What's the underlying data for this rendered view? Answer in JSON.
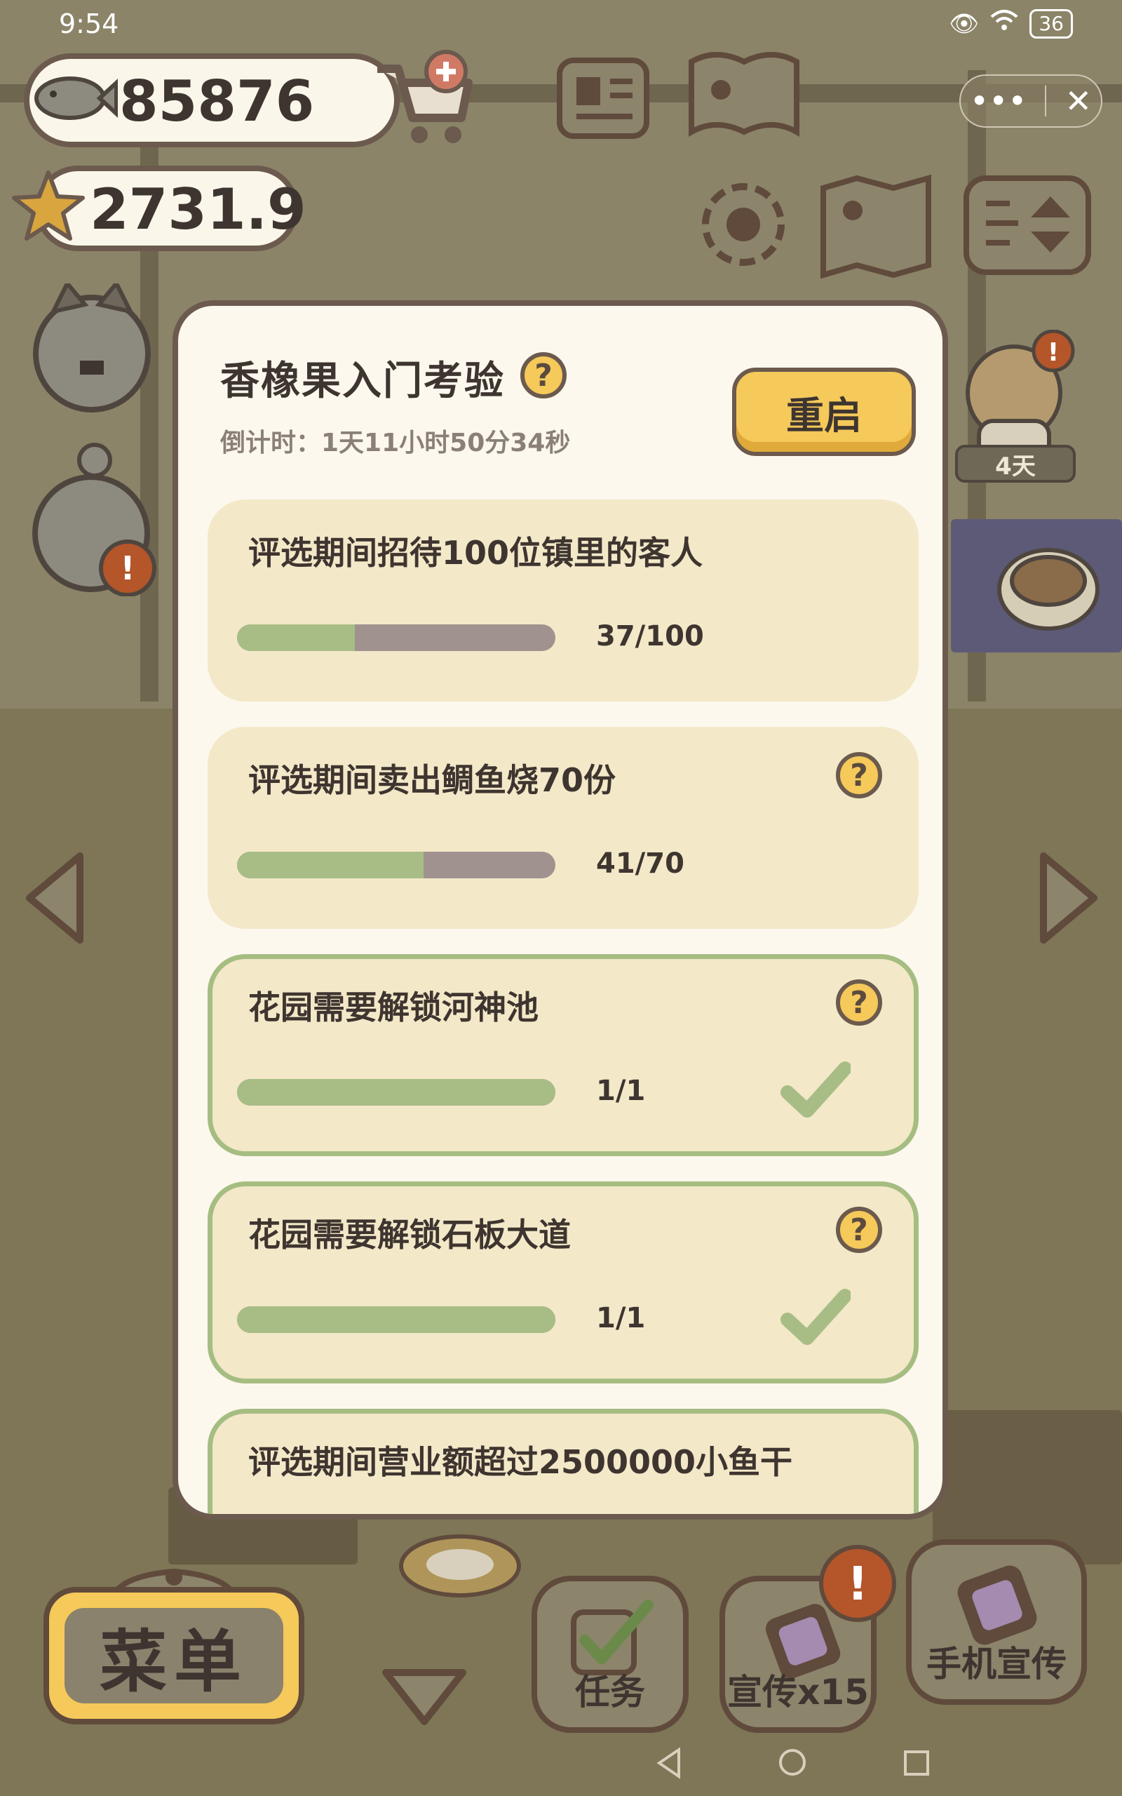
{
  "status_bar": {
    "time": "9:54",
    "battery": "36"
  },
  "currency": {
    "fish": "85876",
    "stars": "2731.9"
  },
  "top_right_menu": {
    "more": "•••",
    "close": "✕"
  },
  "side_badge": {
    "days": "4天"
  },
  "quest": {
    "title": "香橡果入门考验",
    "help_symbol": "?",
    "countdown": "倒计时：1天11小时50分34秒",
    "restart_label": "重启",
    "tasks": [
      {
        "label": "评选期间招待100位镇里的客人",
        "progress_text": "37/100",
        "progress": 0.37,
        "done": false,
        "help": false
      },
      {
        "label": "评选期间卖出鲷鱼烧70份",
        "progress_text": "41/70",
        "progress": 0.5857,
        "done": false,
        "help": true
      },
      {
        "label": "花园需要解锁河神池",
        "progress_text": "1/1",
        "progress": 1,
        "done": true,
        "help": true
      },
      {
        "label": "花园需要解锁石板大道",
        "progress_text": "1/1",
        "progress": 1,
        "done": true,
        "help": true
      },
      {
        "label": "评选期间营业额超过2500000小鱼干",
        "done": true,
        "help": false
      }
    ]
  },
  "bottom_bar": {
    "menu_label": "菜单",
    "tasks_label": "任务",
    "promo_label": "宣传x15",
    "phone_promo_label": "手机宣传",
    "alert_symbol": "!"
  },
  "colors": {
    "panel": "#fdf8ee",
    "card": "#f3e8c8",
    "border": "#6b5a4d",
    "accent_yellow": "#f5c95a",
    "progress_fill": "#a8bd86",
    "progress_track": "#a0928f"
  }
}
